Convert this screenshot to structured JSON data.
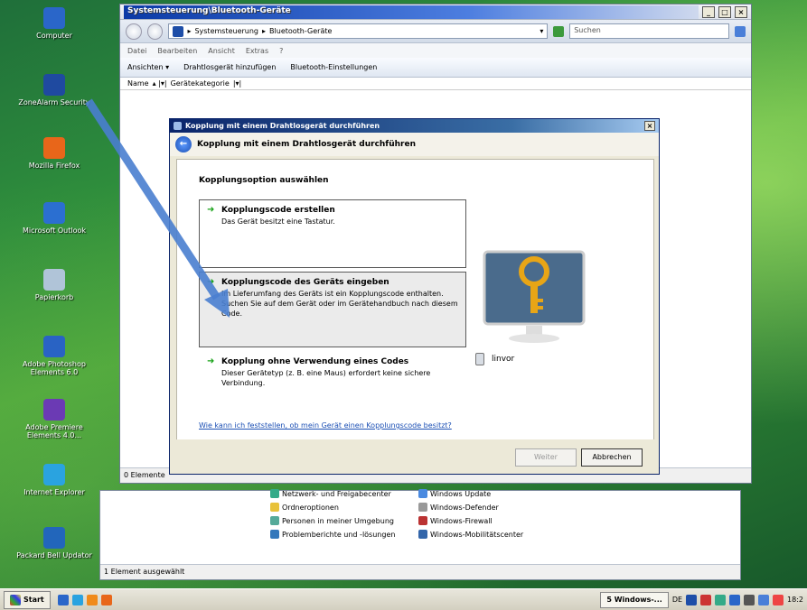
{
  "desktop": {
    "icons": [
      {
        "label": "Computer",
        "color": "#2a66c9"
      },
      {
        "label": "ZoneAlarm Security",
        "color": "#1f4aa0"
      },
      {
        "label": "Mozilla Firefox",
        "color": "#e8661a"
      },
      {
        "label": "Microsoft Outlook",
        "color": "#2b6fd1"
      },
      {
        "label": "Papierkorb",
        "color": "#b0c4d8"
      },
      {
        "label": "Adobe Photoshop Elements 6.0",
        "color": "#2963c4"
      },
      {
        "label": "Adobe Premiere Elements 4.0...",
        "color": "#6b3ab4"
      },
      {
        "label": "Internet Explorer",
        "color": "#2aa3e0"
      },
      {
        "label": "Packard Bell Updator",
        "color": "#2266bb"
      }
    ]
  },
  "window": {
    "title": "Systemsteuerung\\Bluetooth-Geräte",
    "address": [
      "Systemsteuerung",
      "Bluetooth-Geräte"
    ],
    "search_placeholder": "Suchen",
    "menu": [
      "Datei",
      "Bearbeiten",
      "Ansicht",
      "Extras",
      "?"
    ],
    "toolbar": [
      "Ansichten",
      "Drahtlosgerät hinzufügen",
      "Bluetooth-Einstellungen"
    ],
    "headers": [
      "Name",
      "Gerätekategorie"
    ],
    "status": "0 Elemente"
  },
  "back_window": {
    "status": "1 Element ausgewählt",
    "items_left": [
      "Netzwerk- und Freigabecenter",
      "Ordneroptionen",
      "Personen in meiner Umgebung",
      "Problemberichte und -lösungen"
    ],
    "items_right": [
      "Windows Update",
      "Windows-Defender",
      "Windows-Firewall",
      "Windows-Mobilitätscenter"
    ]
  },
  "dialog": {
    "title": "Kopplung mit einem Drahtlosgerät durchführen",
    "header": "Kopplung mit einem Drahtlosgerät durchführen",
    "subtitle": "Kopplungsoption auswählen",
    "options": [
      {
        "title": "Kopplungscode erstellen",
        "desc": "Das Gerät besitzt eine Tastatur."
      },
      {
        "title": "Kopplungscode des Geräts eingeben",
        "desc": "Im Lieferumfang des Geräts ist ein Kopplungscode enthalten. Suchen Sie auf dem Gerät oder im Gerätehandbuch nach diesem Code."
      },
      {
        "title": "Kopplung ohne Verwendung eines Codes",
        "desc": "Dieser Gerätetyp (z. B. eine Maus) erfordert keine sichere Verbindung."
      }
    ],
    "device_name": "linvor",
    "help_link": "Wie kann ich feststellen, ob mein Gerät einen Kopplungscode besitzt?",
    "next_button": "Weiter",
    "cancel_button": "Abbrechen"
  },
  "taskbar": {
    "start": "Start",
    "task": "5 Windows-...",
    "lang": "DE",
    "clock": "18:2"
  }
}
